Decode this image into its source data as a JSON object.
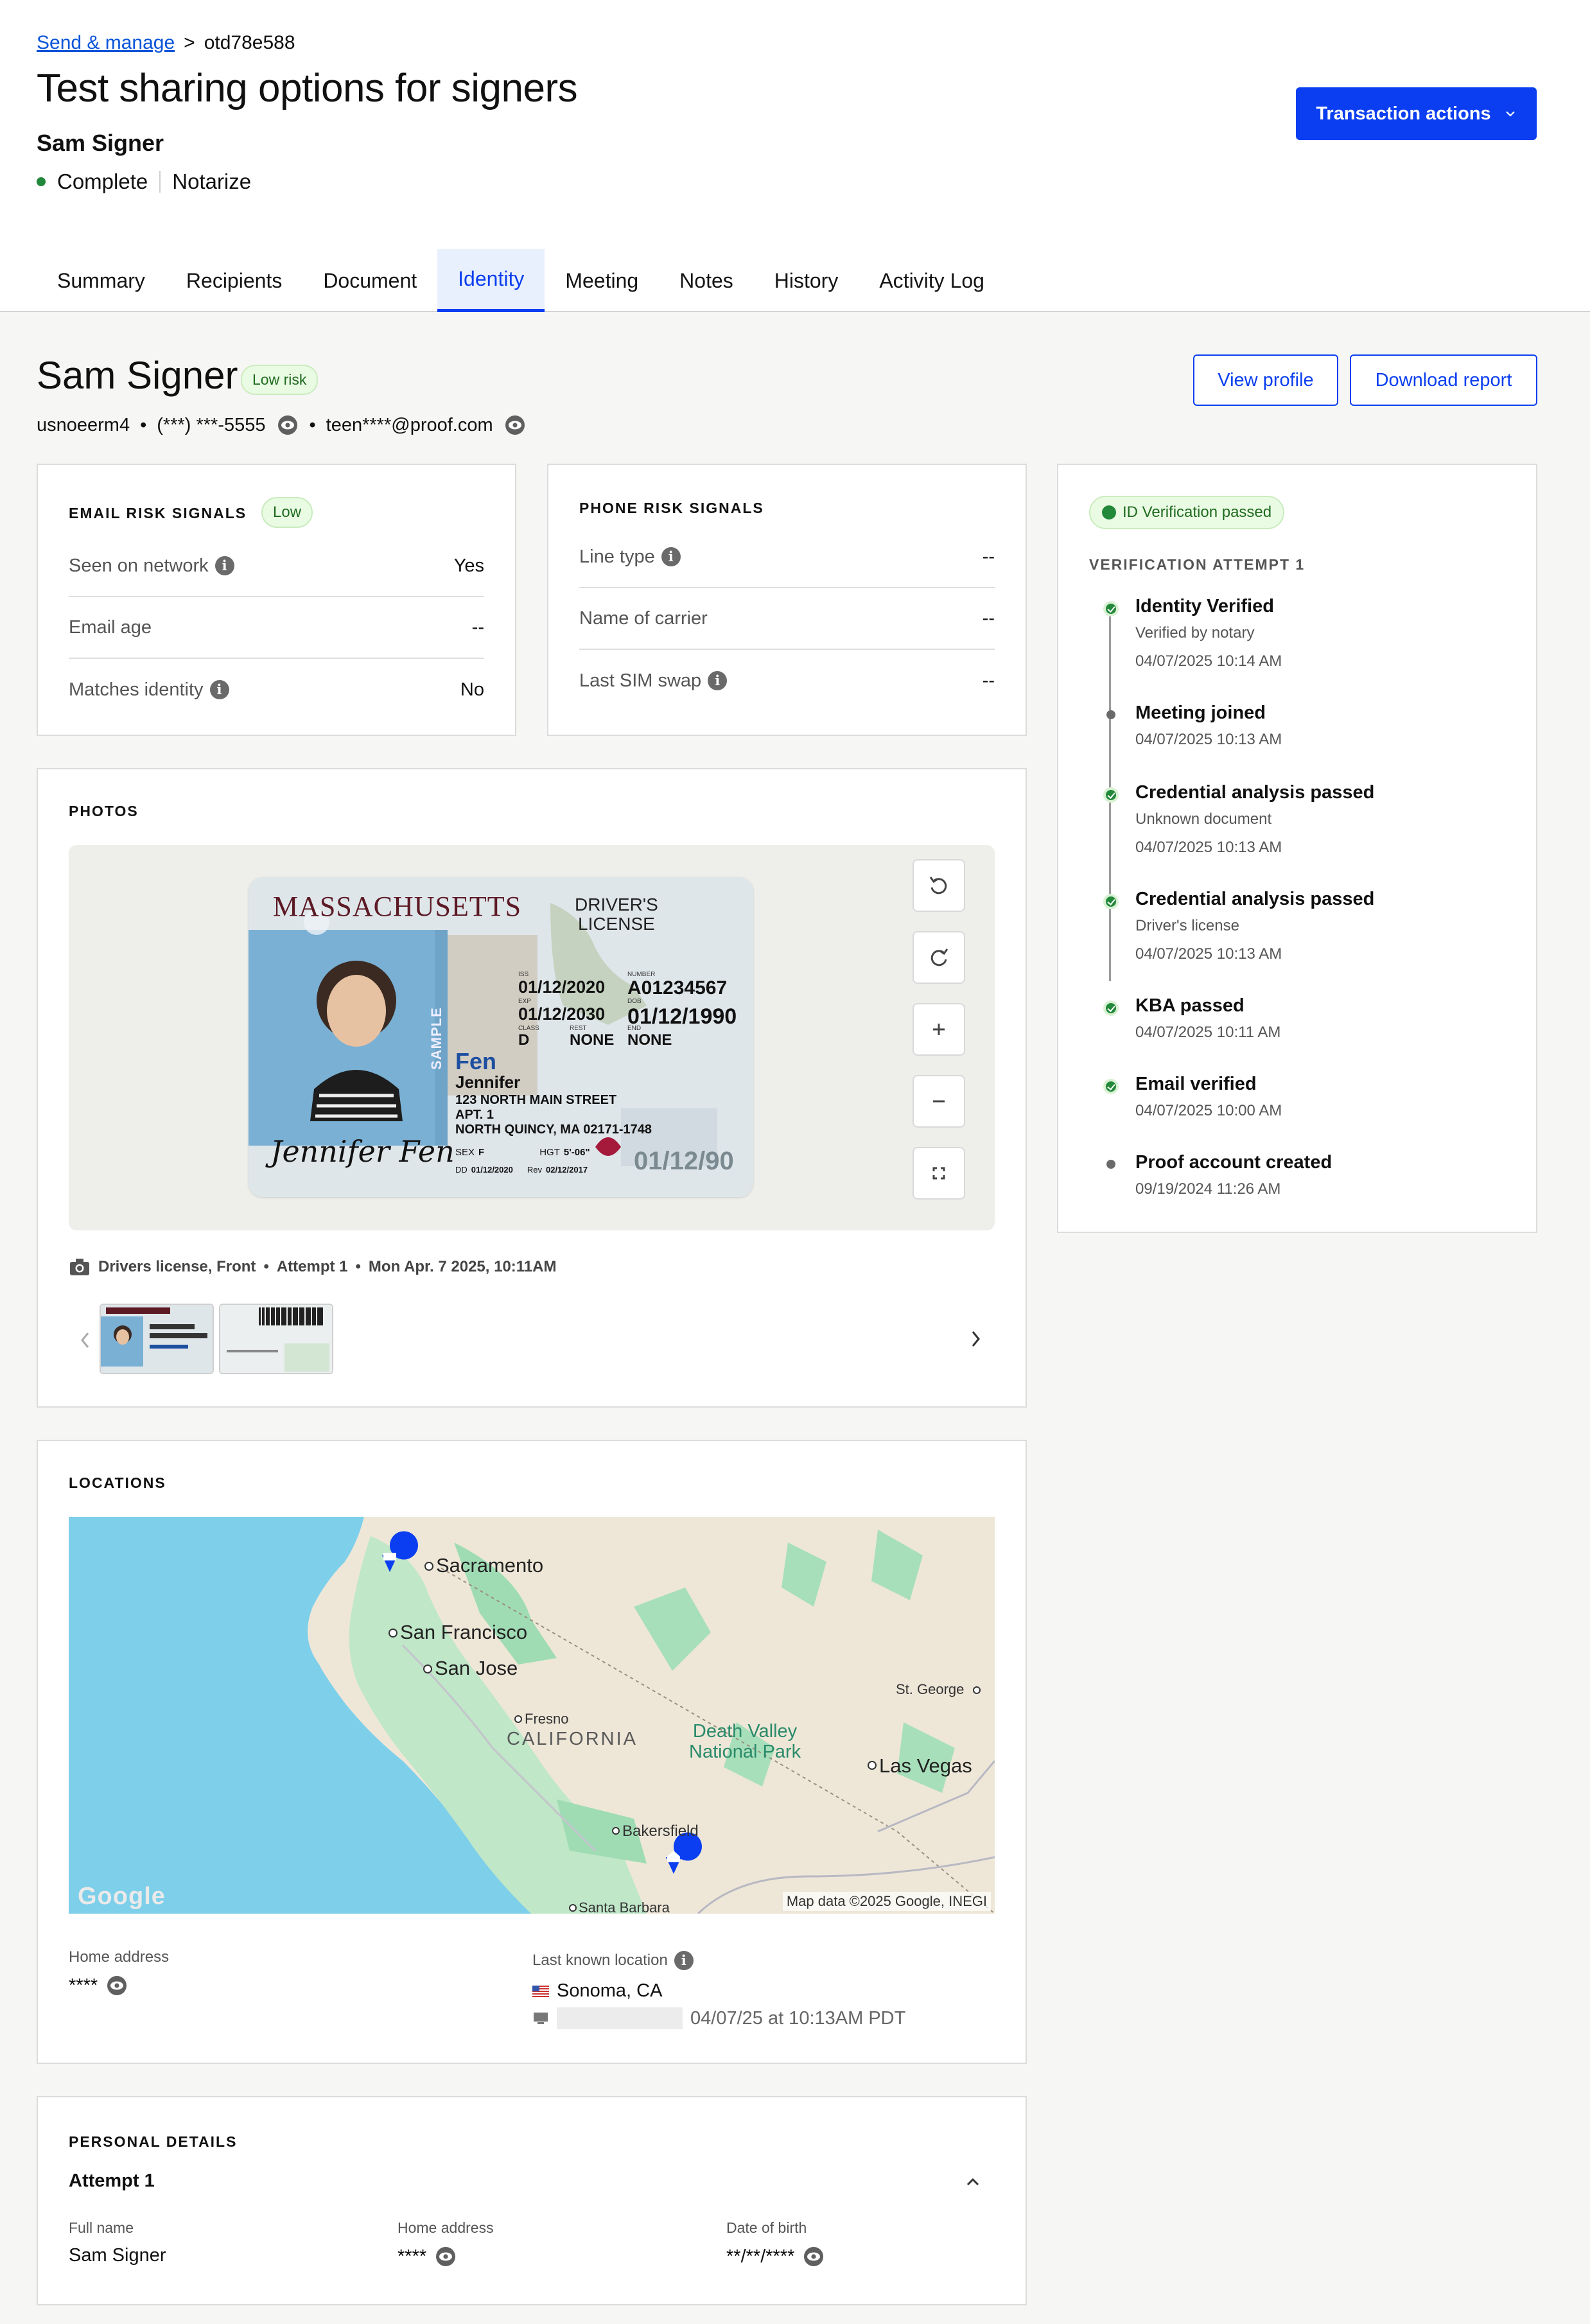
{
  "breadcrumb": {
    "link": "Send & manage",
    "separator": ">",
    "current": "otd78e588"
  },
  "header": {
    "title": "Test sharing options for signers",
    "signer": "Sam Signer",
    "status": "Complete",
    "type": "Notarize",
    "transaction_actions": "Transaction actions"
  },
  "tabs": [
    "Summary",
    "Recipients",
    "Document",
    "Identity",
    "Meeting",
    "Notes",
    "History",
    "Activity Log"
  ],
  "identity": {
    "name": "Sam Signer",
    "risk": "Low risk",
    "user_id": "usnoeerm4",
    "phone": "(***) ***-5555",
    "email": "teen****@proof.com",
    "view_profile": "View profile",
    "download_report": "Download report"
  },
  "email_signals": {
    "heading": "EMAIL RISK SIGNALS",
    "badge": "Low",
    "rows": [
      {
        "label": "Seen on network",
        "value": "Yes"
      },
      {
        "label": "Email age",
        "value": "--"
      },
      {
        "label": "Matches identity",
        "value": "No"
      }
    ]
  },
  "phone_signals": {
    "heading": "PHONE RISK SIGNALS",
    "rows": [
      {
        "label": "Line type",
        "value": "--"
      },
      {
        "label": "Name of carrier",
        "value": "--"
      },
      {
        "label": "Last SIM swap",
        "value": "--"
      }
    ]
  },
  "photos": {
    "heading": "PHOTOS",
    "caption_doc": "Drivers license, Front",
    "caption_attempt": "Attempt 1",
    "caption_date": "Mon Apr. 7 2025, 10:11AM",
    "card": {
      "state": "MASSACHUSETTS",
      "doc": "DRIVER'S",
      "doc2": "LICENSE",
      "iss_label": "ISS",
      "iss": "01/12/2020",
      "exp_label": "EXP",
      "exp": "01/12/2030",
      "number_label": "NUMBER",
      "number": "A01234567",
      "dob_label": "DOB",
      "dob": "01/12/1990",
      "class_label": "CLASS",
      "class": "D",
      "rest_label": "REST",
      "rest": "NONE",
      "end_label": "END",
      "end": "NONE",
      "last": "Fen",
      "first": "Jennifer",
      "addr1": "123 NORTH MAIN STREET",
      "addr2": "APT. 1",
      "addr3": "NORTH QUINCY, MA 02171-1748",
      "sex_label": "SEX",
      "sex": "F",
      "hgt_label": "HGT",
      "hgt": "5'-06\"",
      "dd_label": "DD",
      "dd": "01/12/2020",
      "rev_label": "Rev",
      "rev": "02/12/2017",
      "dob_ghost": "01/12/90",
      "sample": "SAMPLE",
      "signature": "Jennifer Fen"
    }
  },
  "locations": {
    "heading": "LOCATIONS",
    "map_labels": {
      "sacramento": "Sacramento",
      "sf": "San Francisco",
      "sj": "San Jose",
      "fresno": "Fresno",
      "california": "CALIFORNIA",
      "dv1": "Death Valley",
      "dv2": "National Park",
      "lv": "Las Vegas",
      "stg": "St. George",
      "bak": "Bakersfield",
      "sb": "Santa Barbara",
      "attribution": "Map data ©2025 Google, INEGI",
      "logo": "Google"
    },
    "home_label": "Home address",
    "home_value": "****",
    "last_label": "Last known location",
    "last_city": "Sonoma, CA",
    "last_time": "04/07/25 at 10:13AM PDT"
  },
  "personal": {
    "heading": "PERSONAL DETAILS",
    "attempt": "Attempt 1",
    "full_name_label": "Full name",
    "full_name": "Sam Signer",
    "home_label": "Home address",
    "home": "****",
    "dob_label": "Date of birth",
    "dob": "**/**/****"
  },
  "verification": {
    "badge": "ID Verification passed",
    "heading": "VERIFICATION ATTEMPT 1",
    "events": [
      {
        "title": "Identity Verified",
        "sub": "Verified by notary",
        "time": "04/07/2025 10:14 AM",
        "ok": true
      },
      {
        "title": "Meeting joined",
        "sub": "",
        "time": "04/07/2025 10:13 AM",
        "ok": false
      },
      {
        "title": "Credential analysis passed",
        "sub": "Unknown document",
        "time": "04/07/2025 10:13 AM",
        "ok": true
      },
      {
        "title": "Credential analysis passed",
        "sub": "Driver's license",
        "time": "04/07/2025 10:13 AM",
        "ok": true
      },
      {
        "title": "KBA passed",
        "sub": "",
        "time": "04/07/2025 10:11 AM",
        "ok": true
      },
      {
        "title": "Email verified",
        "sub": "",
        "time": "04/07/2025 10:00 AM",
        "ok": true
      },
      {
        "title": "Proof account created",
        "sub": "",
        "time": "09/19/2024 11:26 AM",
        "ok": false
      }
    ]
  }
}
